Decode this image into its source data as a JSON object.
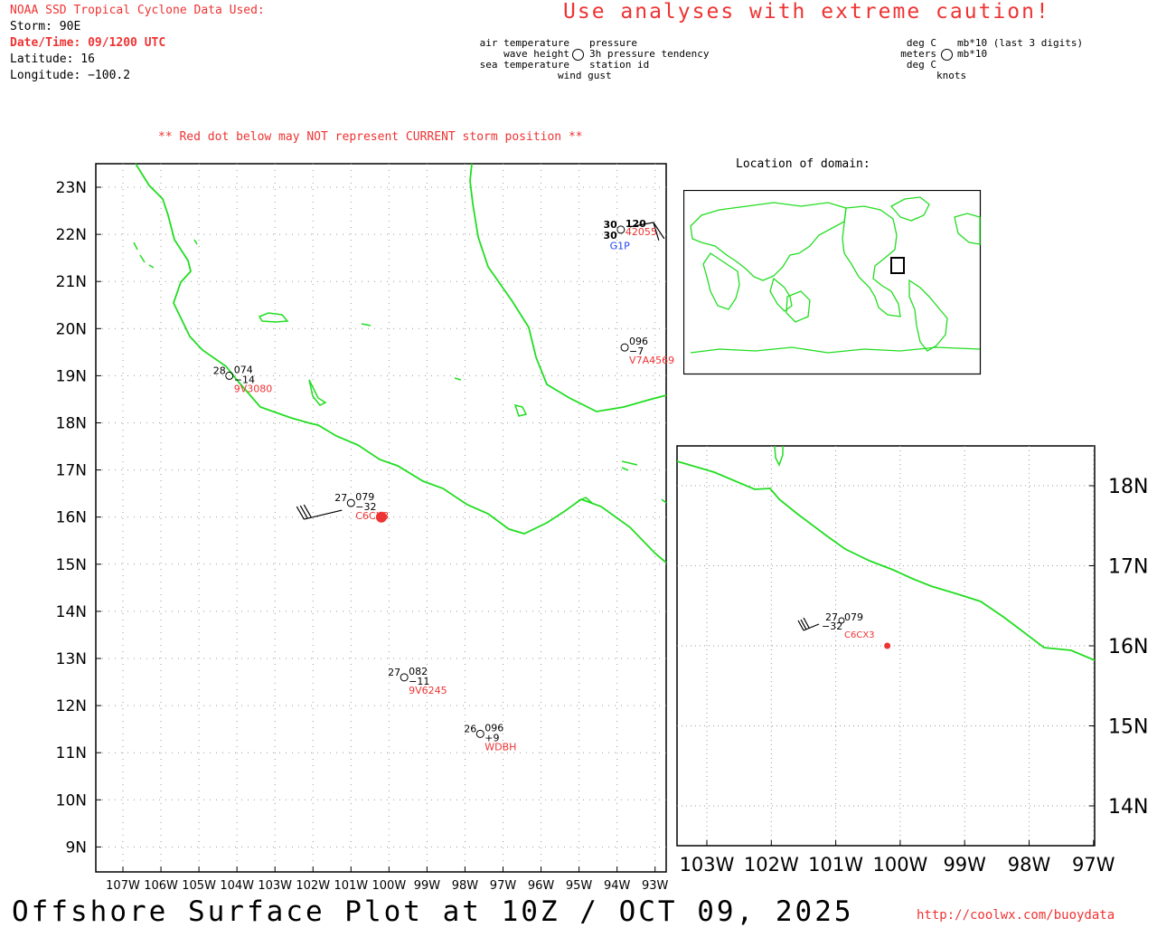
{
  "header": {
    "source_title": "NOAA SSD Tropical Cyclone Data Used:",
    "storm": "Storm: 90E",
    "datetime": "Date/Time: 09/1200 UTC",
    "latitude": "Latitude: 16",
    "longitude": "Longitude: −100.2",
    "caution": "Use analyses with extreme caution!",
    "red_dot_note": "** Red dot below may NOT represent CURRENT storm position **"
  },
  "station_legend": {
    "left_labels": [
      "air temperature",
      "wave height",
      "sea temperature"
    ],
    "right_labels": [
      "pressure",
      "3h pressure tendency",
      "station id"
    ],
    "bottom_label": "wind gust",
    "units_left": [
      "deg C",
      "meters",
      "deg C"
    ],
    "units_right": [
      "mb*10 (last 3 digits)",
      "mb*10"
    ],
    "units_bottom": "knots"
  },
  "locator": {
    "title": "Location of domain:"
  },
  "main_map": {
    "lat_labels": [
      "23N",
      "22N",
      "21N",
      "20N",
      "19N",
      "18N",
      "17N",
      "16N",
      "15N",
      "14N",
      "13N",
      "12N",
      "11N",
      "10N",
      "9N"
    ],
    "lon_labels": [
      "107W",
      "106W",
      "105W",
      "104W",
      "103W",
      "102W",
      "101W",
      "100W",
      "99W",
      "98W",
      "97W",
      "96W",
      "95W",
      "94W",
      "93W"
    ],
    "storm_center": {
      "lat": 16.0,
      "lon": -100.2
    },
    "stations": [
      {
        "id": "C6CX3",
        "lat": 16.3,
        "lon": -101.0,
        "air_temp": "27",
        "sea_temp": "",
        "pressure": "079",
        "tendency": "−32",
        "has_wind": true
      },
      {
        "id": "9V3080",
        "lat": 19.0,
        "lon": -104.2,
        "air_temp": "28",
        "sea_temp": "",
        "pressure": "074",
        "tendency": "−14",
        "has_wind": false
      },
      {
        "id": "V7A4569",
        "lat": 19.6,
        "lon": -93.8,
        "air_temp": "",
        "sea_temp": "",
        "pressure": "096",
        "tendency": "−7",
        "has_wind": false
      },
      {
        "id": "9V6245",
        "lat": 12.6,
        "lon": -99.6,
        "air_temp": "27",
        "sea_temp": "",
        "pressure": "082",
        "tendency": "−11",
        "has_wind": false
      },
      {
        "id": "WDBH",
        "lat": 11.4,
        "lon": -97.6,
        "air_temp": "26",
        "sea_temp": "",
        "pressure": "096",
        "tendency": "+9",
        "has_wind": false
      },
      {
        "id": "42055",
        "lat": 22.1,
        "lon": -93.9,
        "air_temp": "30",
        "sea_temp": "30",
        "pressure": "120",
        "tendency": "",
        "has_wind": true
      },
      {
        "id": "G1P",
        "lat": 21.8,
        "lon": -94.0,
        "air_temp": "",
        "sea_temp": "",
        "pressure": "",
        "tendency": "",
        "has_wind": false
      }
    ]
  },
  "inset_map": {
    "lat_labels": [
      "18N",
      "17N",
      "16N",
      "15N",
      "14N"
    ],
    "lon_labels": [
      "103W",
      "102W",
      "101W",
      "100W",
      "99W",
      "98W",
      "97W"
    ],
    "storm_center": {
      "lat": 16.0,
      "lon": -100.2
    },
    "station": {
      "id": "C6CX3",
      "air_temp": "27",
      "pressure": "079",
      "tendency": "−32"
    }
  },
  "footer": {
    "title": "Offshore Surface Plot at 10Z / OCT 09, 2025",
    "url": "http://coolwx.com/buoydata"
  },
  "colors": {
    "coast": "#22dd22",
    "accent_red": "#ee3333",
    "station_blue": "#2244ee",
    "grid": "#999999"
  }
}
